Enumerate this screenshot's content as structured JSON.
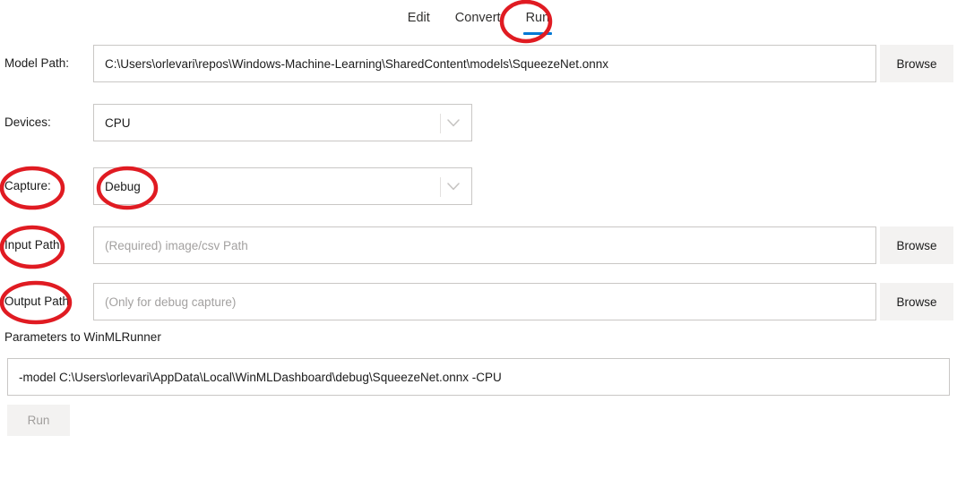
{
  "tabs": [
    {
      "label": "Edit",
      "active": false
    },
    {
      "label": "Convert",
      "active": false
    },
    {
      "label": "Run",
      "active": true
    }
  ],
  "form": {
    "model_path": {
      "label": "Model Path:",
      "value": "C:\\Users\\orlevari\\repos\\Windows-Machine-Learning\\SharedContent\\models\\SqueezeNet.onnx",
      "browse_label": "Browse"
    },
    "devices": {
      "label": "Devices:",
      "value": "CPU",
      "chevron": "chevron-down-icon"
    },
    "capture": {
      "label": "Capture:",
      "value": "Debug",
      "chevron": "chevron-down-icon"
    },
    "input_path": {
      "label": "Input Path:",
      "placeholder": "(Required) image/csv Path",
      "browse_label": "Browse"
    },
    "output_path": {
      "label": "Output Path:",
      "placeholder": "(Only for debug capture)",
      "browse_label": "Browse"
    },
    "parameters": {
      "label": "Parameters to WinMLRunner",
      "value": "-model C:\\Users\\orlevari\\AppData\\Local\\WinMLDashboard\\debug\\SqueezeNet.onnx -CPU"
    },
    "run_button": {
      "label": "Run",
      "enabled": false
    }
  },
  "annotations": {
    "color": "#e01b22",
    "stroke_width": 4,
    "targets": [
      "run-tab",
      "capture-label",
      "capture-value",
      "input-path-label",
      "output-path-label"
    ]
  },
  "colors": {
    "accent": "#0078d4",
    "annotation_red": "#e01b22",
    "field_border": "#c9c7c5",
    "button_bg": "#f3f2f1",
    "disabled_text": "#a19f9d",
    "placeholder_text": "#a3a1a0",
    "text": "#1b1b1b",
    "background": "#ffffff"
  }
}
